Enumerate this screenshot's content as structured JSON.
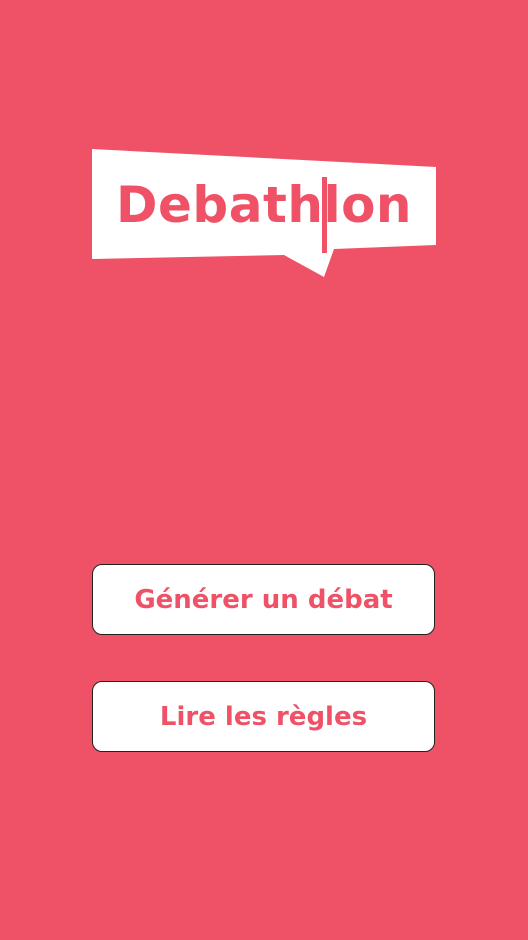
{
  "app": {
    "logo_text": "Debathlon"
  },
  "buttons": {
    "generate_label": "Générer un débat",
    "rules_label": "Lire les règles"
  },
  "colors": {
    "background": "#EF5266",
    "button_background": "#FFFFFF",
    "accent": "#EF5266"
  }
}
